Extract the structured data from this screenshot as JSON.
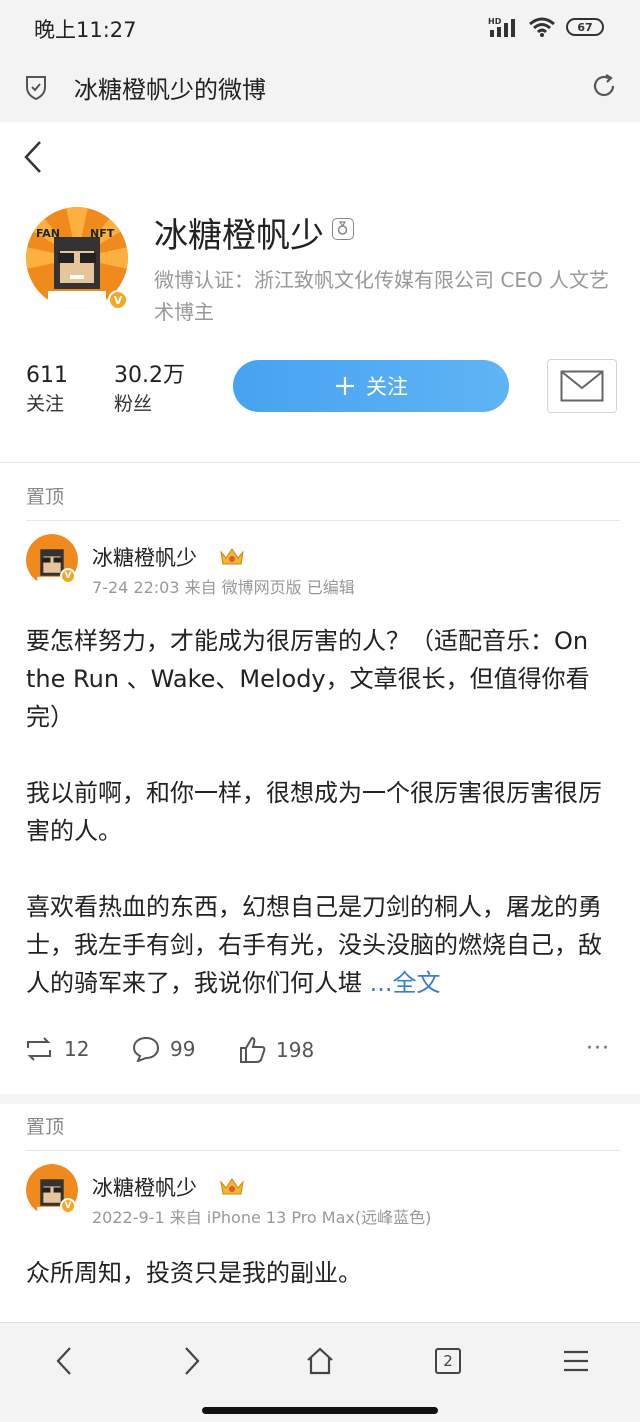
{
  "status_bar": {
    "time": "晚上11:27",
    "battery": "67"
  },
  "browser": {
    "title": "冰糖橙帆少的微博"
  },
  "profile": {
    "name": "冰糖橙帆少",
    "verification": "微博认证：浙江致帆文化传媒有限公司 CEO 人文艺术博主",
    "following_count": "611",
    "following_label": "关注",
    "followers_count": "30.2万",
    "followers_label": "粉丝",
    "follow_button": "关注",
    "avatar_text_left": "FAN",
    "avatar_text_right": "NFT"
  },
  "posts": [
    {
      "pinned_label": "置顶",
      "author": "冰糖橙帆少",
      "meta": "7-24 22:03 来自 微博网页版 已编辑",
      "paragraphs": [
        "要怎样努力，才能成为很厉害的人？（适配音乐：On the Run 、Wake、Melody，文章很长，但值得你看完）",
        "我以前啊，和你一样，很想成为一个很厉害很厉害很厉害的人。",
        "喜欢看热血的东西，幻想自己是刀剑的桐人，屠龙的勇士，我左手有剑，右手有光，没头没脑的燃烧自己，敌人的骑军来了，我说你们何人堪 "
      ],
      "full_text_link": "...全文",
      "reposts": "12",
      "comments": "99",
      "likes": "198"
    },
    {
      "pinned_label": "置顶",
      "author": "冰糖橙帆少",
      "meta": "2022-9-1 来自 iPhone 13 Pro Max(远峰蓝色)",
      "text": "众所周知，投资只是我的副业。"
    }
  ],
  "bottom_nav": {
    "tab_count": "2"
  },
  "colors": {
    "accent": "#3a7fd0",
    "follow_button": "#4aa5f2",
    "badge": "#f5a623"
  }
}
